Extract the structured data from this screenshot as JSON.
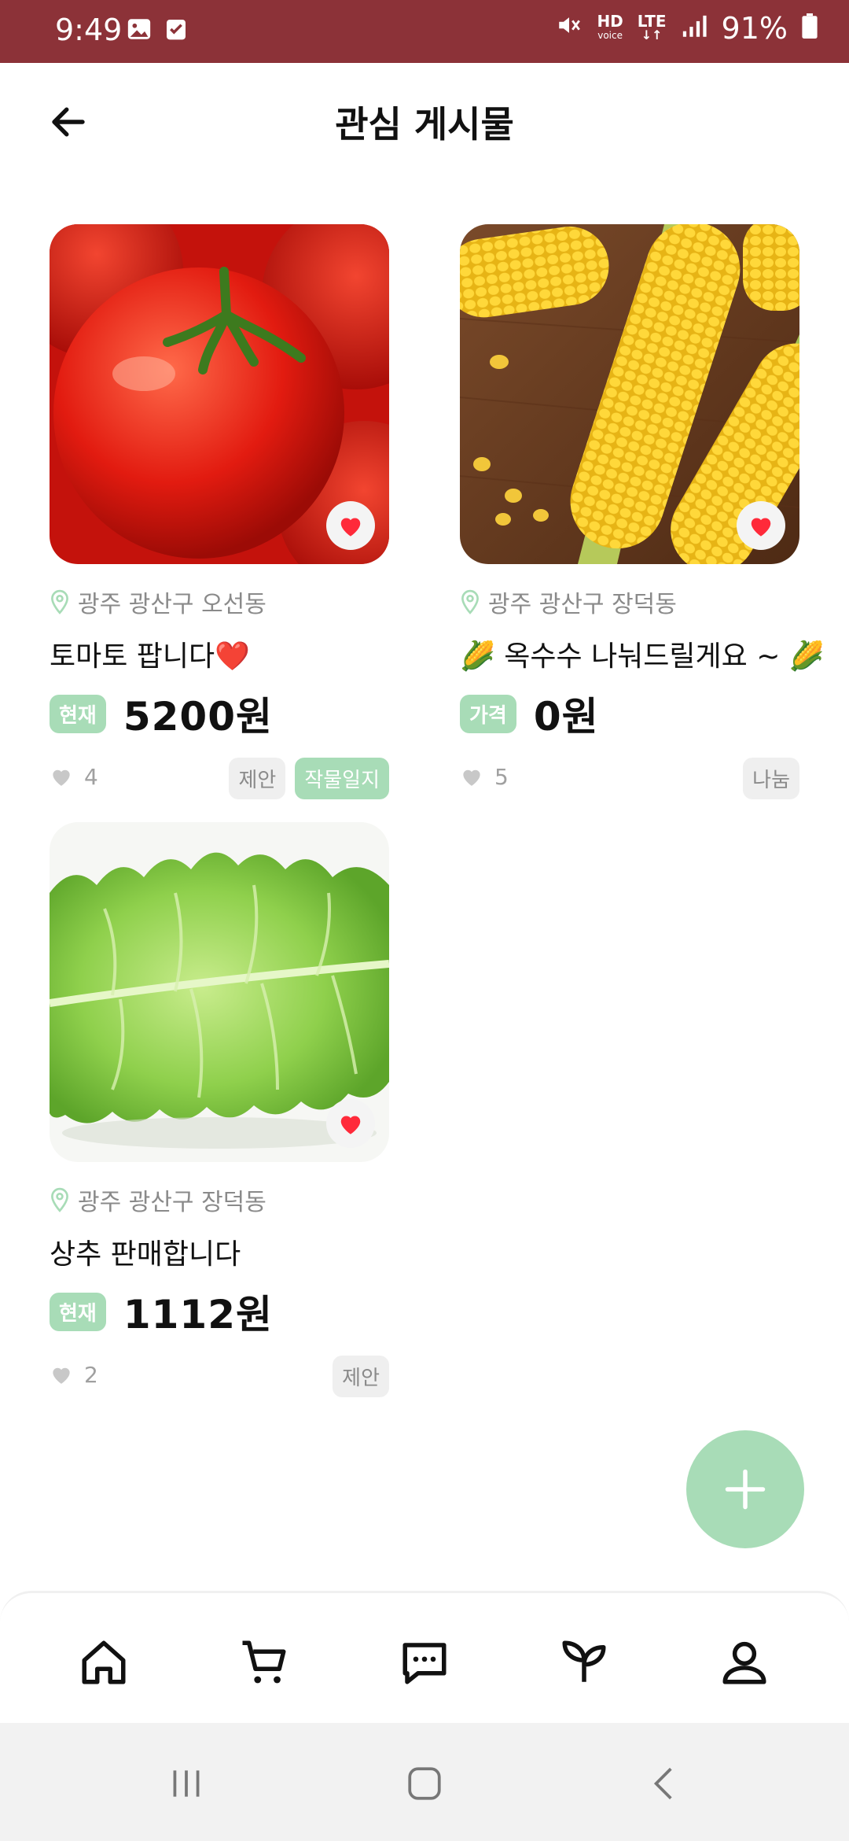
{
  "status_bar": {
    "time": "9:49",
    "hd_label": "HD",
    "voice_label": "voice",
    "lte_label": "LTE",
    "battery": "91%"
  },
  "header": {
    "title": "관심 게시물"
  },
  "posts": [
    {
      "image": "tomato-photo",
      "location": "광주 광산구 오선동",
      "title": "토마토 팝니다❤️",
      "price_badge": "현재",
      "price": "5200원",
      "likes": "4",
      "tags": [
        "제안",
        "작물일지"
      ]
    },
    {
      "image": "corn-photo",
      "location": "광주 광산구 장덕동",
      "title": "🌽 옥수수 나눠드릴게요 ~ 🌽",
      "price_badge": "가격",
      "price": "0원",
      "likes": "5",
      "tags": [
        "나눔"
      ]
    },
    {
      "image": "lettuce-photo",
      "location": "광주 광산구 장덕동",
      "title": "상추 판매합니다",
      "price_badge": "현재",
      "price": "1112원",
      "likes": "2",
      "tags": [
        "제안"
      ]
    }
  ],
  "colors": {
    "status_bar": "#8c3238",
    "accent_green": "#a8dcb7",
    "heart_red": "#ff2a3a"
  },
  "bottom_nav": [
    "home-icon",
    "cart-icon",
    "chat-icon",
    "sprout-icon",
    "profile-icon"
  ]
}
